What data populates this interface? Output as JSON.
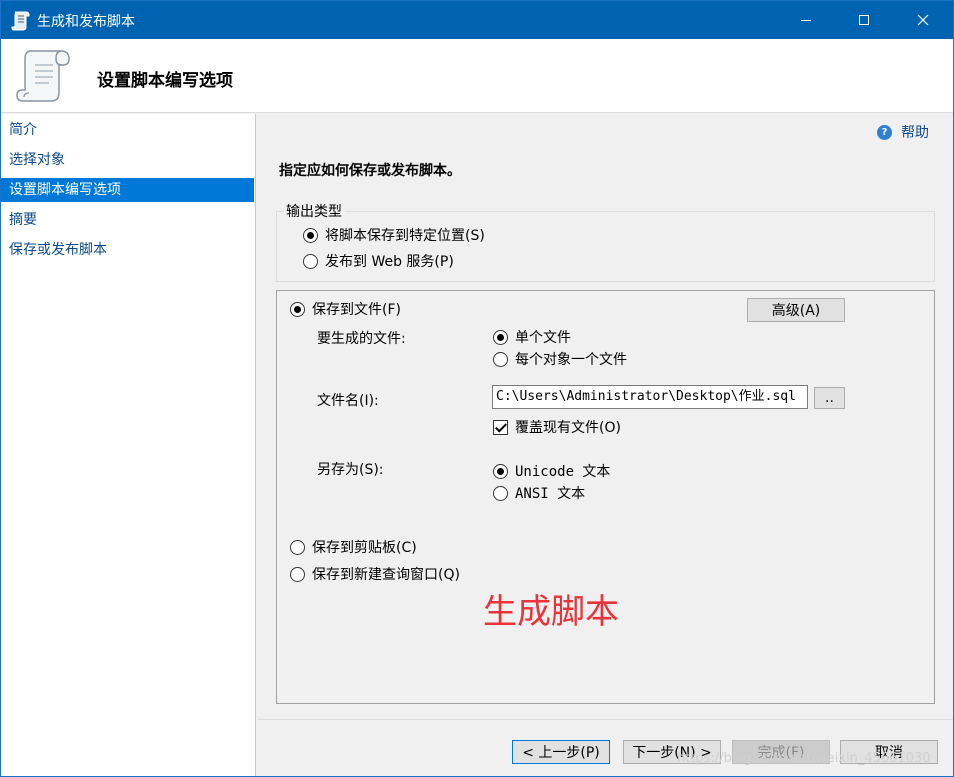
{
  "window": {
    "title": "生成和发布脚本",
    "colors": {
      "titlebar": "#0063b1",
      "selection": "#0078d7",
      "watermark": "#e8333a"
    }
  },
  "header": {
    "title": "设置脚本编写选项",
    "icon": "scroll-icon"
  },
  "sidebar": {
    "items": [
      {
        "label": "简介"
      },
      {
        "label": "选择对象"
      },
      {
        "label": "设置脚本编写选项",
        "active": true
      },
      {
        "label": "摘要"
      },
      {
        "label": "保存或发布脚本"
      }
    ]
  },
  "main": {
    "help_label": "帮助",
    "instruction": "指定应如何保存或发布脚本。",
    "output_group": {
      "legend": "输出类型",
      "opt_save": "将脚本保存到特定位置(S)",
      "opt_web": "发布到 Web 服务(P)",
      "selected": "save"
    },
    "file_group": {
      "save_to_file": "保存到文件(F)",
      "advanced": "高级(A)",
      "files_label": "要生成的文件:",
      "single_file": "单个文件",
      "file_per_object": "每个对象一个文件",
      "filename_label": "文件名(I):",
      "filename_value": "C:\\Users\\Administrator\\Desktop\\作业.sql",
      "browse": "..",
      "overwrite": "覆盖现有文件(O)",
      "save_as_label": "另存为(S):",
      "unicode": "Unicode 文本",
      "ansi": "ANSI 文本",
      "clipboard": "保存到剪贴板(C)",
      "new_query": "保存到新建查询窗口(Q)"
    },
    "watermark": "生成脚本"
  },
  "footer": {
    "back": "< 上一步(P)",
    "next": "下一步(N) >",
    "finish": "完成(F)",
    "cancel": "取消",
    "url": "https://blog.csdn.net/weixin_45661030"
  }
}
